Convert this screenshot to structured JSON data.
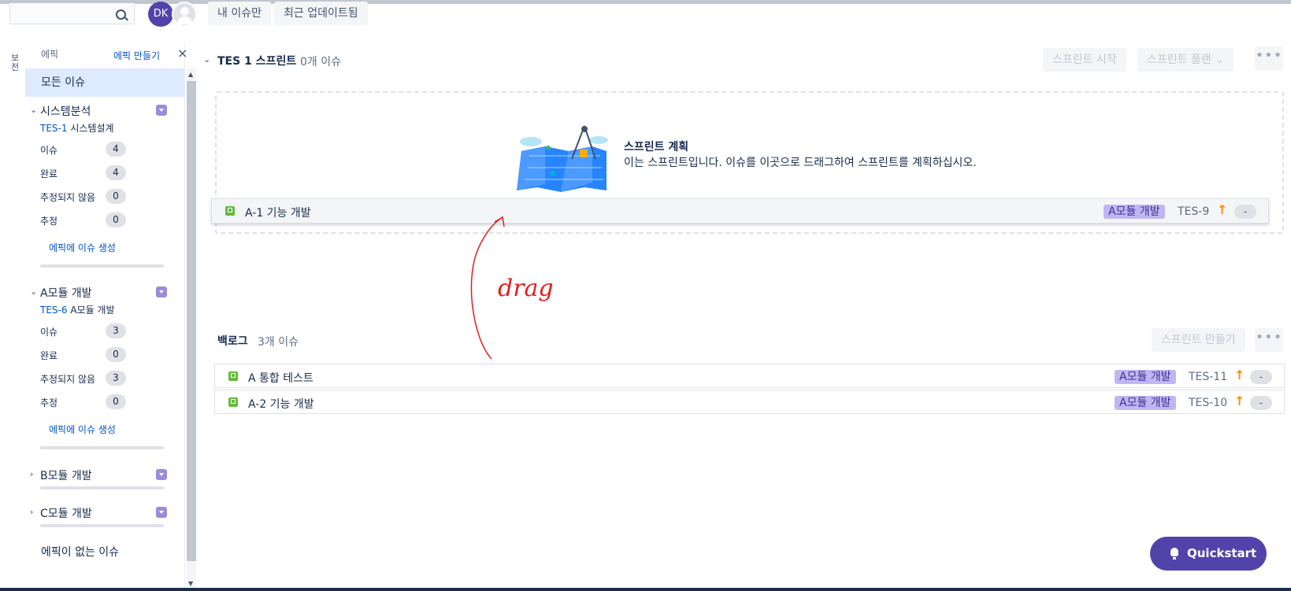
{
  "topbar": {
    "search_placeholder": "",
    "avatar_initials": "DK",
    "filters": [
      "내 이슈만",
      "최근 업데이트됨"
    ]
  },
  "sidebar_tab": "보전",
  "epic_panel": {
    "heading": "에픽",
    "create_label": "에픽 만들기",
    "close_glyph": "×",
    "all_issues": "모든 이슈",
    "epics": [
      {
        "name": "시스템분석",
        "key": "TES-1",
        "key_title": "시스템설계",
        "expanded": true,
        "stats": [
          {
            "label": "이슈",
            "value": "4"
          },
          {
            "label": "완료",
            "value": "4"
          },
          {
            "label": "추정되지 않음",
            "value": "0"
          },
          {
            "label": "추정",
            "value": "0"
          }
        ],
        "create_issue": "에픽에 이슈 생성"
      },
      {
        "name": "A모듈 개발",
        "key": "TES-6",
        "key_title": "A모듈 개발",
        "expanded": true,
        "stats": [
          {
            "label": "이슈",
            "value": "3"
          },
          {
            "label": "완료",
            "value": "0"
          },
          {
            "label": "추정되지 않음",
            "value": "3"
          },
          {
            "label": "추정",
            "value": "0"
          }
        ],
        "create_issue": "에픽에 이슈 생성"
      },
      {
        "name": "B모듈 개발",
        "expanded": false
      },
      {
        "name": "C모듈 개발",
        "expanded": false
      }
    ],
    "no_epic": "에픽이 없는 이슈"
  },
  "sprint": {
    "title": "TES 1 스프린트",
    "count": "0개 이슈",
    "start_label": "스프린트 시작",
    "plan_label": "스프린트 플랜",
    "more": "•••",
    "empty_title": "스프린트 계획",
    "empty_desc": "이는 스프린트입니다. 이슈를 이곳으로 드래그하여 스프린트를 계획하십시오."
  },
  "dragged_issue": {
    "summary": "A-1 기능 개발",
    "epic": "A모듈 개발",
    "key": "TES-9",
    "priority": "↑",
    "estimate": "-"
  },
  "annotation": {
    "text": "drag",
    "color": "#e0201d"
  },
  "backlog": {
    "title": "백로그",
    "count": "3개 이슈",
    "create_sprint": "스프린트 만들기",
    "more": "•••",
    "issues": [
      {
        "summary": "A 통합 테스트",
        "epic": "A모듈 개발",
        "key": "TES-11",
        "priority": "↑",
        "estimate": "-"
      },
      {
        "summary": "A-2 기능 개발",
        "epic": "A모듈 개발",
        "key": "TES-10",
        "priority": "↑",
        "estimate": "-"
      }
    ]
  },
  "quickstart": {
    "label": "Quickstart"
  },
  "colors": {
    "accent": "#5243aa",
    "link": "#0052cc",
    "story": "#63ba3c",
    "epic_lozenge": "#c0b6f2",
    "priority": "#ff8b00"
  }
}
